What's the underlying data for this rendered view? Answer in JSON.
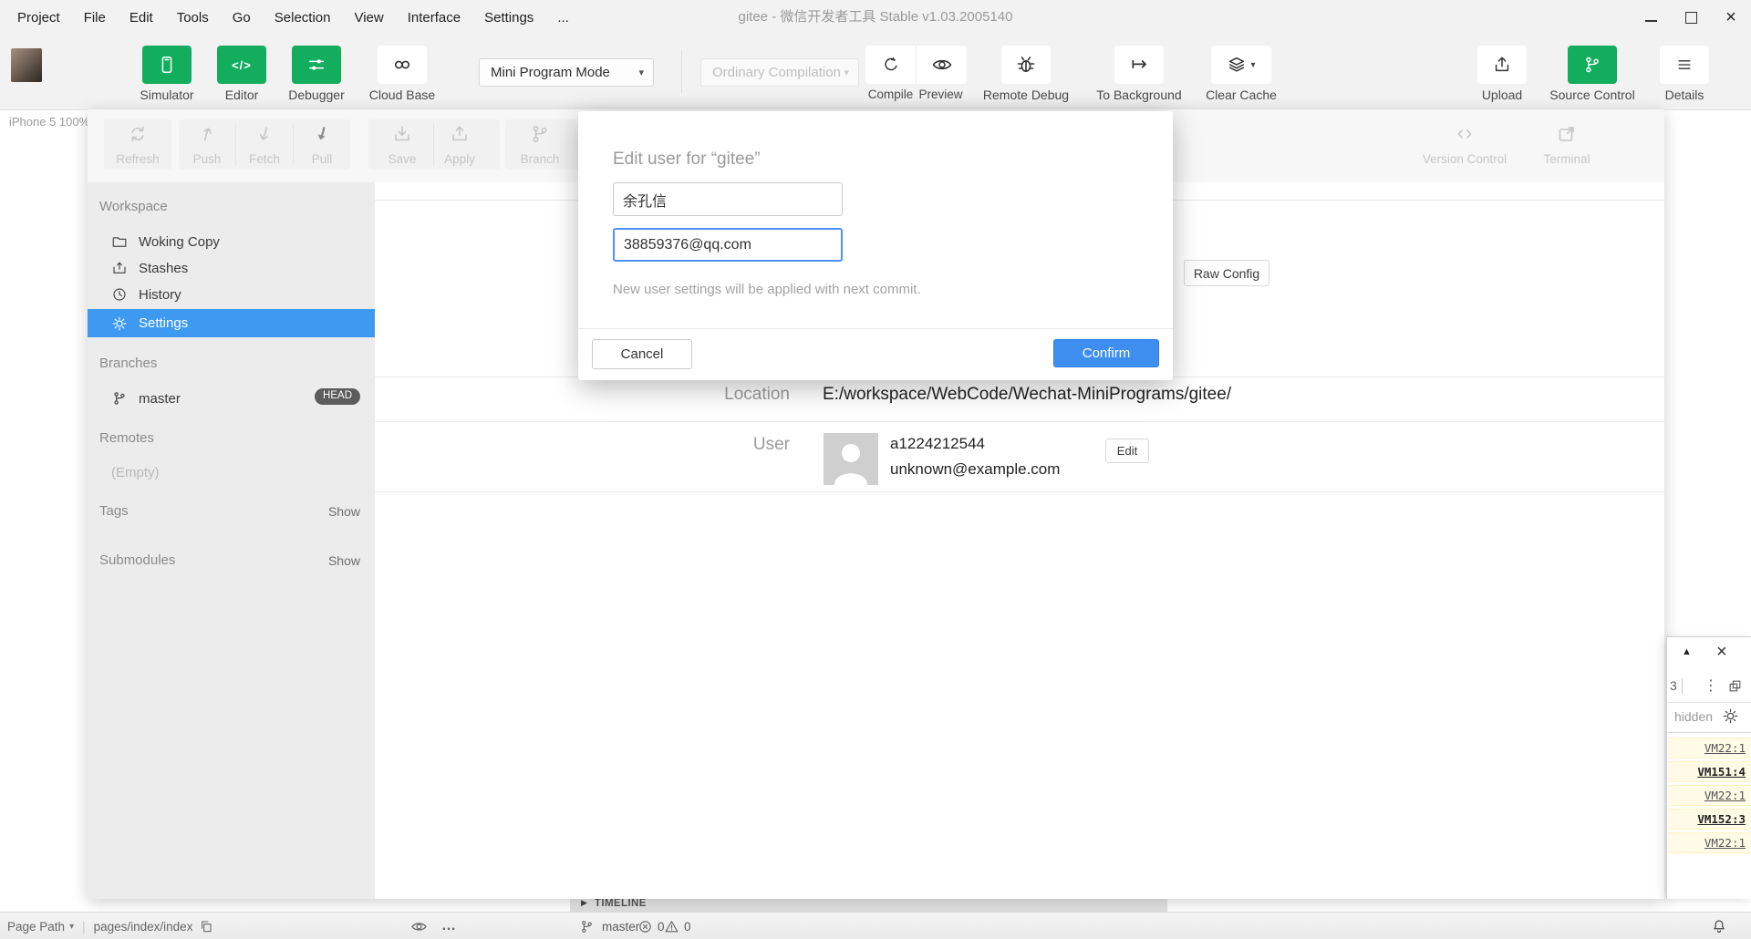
{
  "window": {
    "menu": [
      "Project",
      "File",
      "Edit",
      "Tools",
      "Go",
      "Selection",
      "View",
      "Interface",
      "Settings",
      "..."
    ],
    "title": "gitee - 微信开发者工具 Stable v1.03.2005140"
  },
  "toolbar": {
    "simulator": "Simulator",
    "editor": "Editor",
    "debugger": "Debugger",
    "cloud_base": "Cloud Base",
    "mode_select": "Mini Program Mode",
    "compile_select": "Ordinary Compilation",
    "compile": "Compile",
    "preview": "Preview",
    "remote_debug": "Remote Debug",
    "to_background": "To Background",
    "clear_cache": "Clear Cache",
    "upload": "Upload",
    "source_control": "Source Control",
    "details": "Details"
  },
  "simulator": {
    "device_label": "iPhone 5 100%"
  },
  "git": {
    "toolbar": {
      "refresh": "Refresh",
      "push": "Push",
      "fetch": "Fetch",
      "pull": "Pull",
      "save": "Save",
      "apply": "Apply",
      "branch": "Branch",
      "version_control": "Version Control",
      "terminal": "Terminal"
    },
    "sidebar": {
      "workspace_label": "Workspace",
      "items": [
        {
          "label": "Woking Copy"
        },
        {
          "label": "Stashes"
        },
        {
          "label": "History"
        },
        {
          "label": "Settings"
        }
      ],
      "branches_label": "Branches",
      "branch_name": "master",
      "head_badge": "HEAD",
      "remotes_label": "Remotes",
      "remotes_empty": "(Empty)",
      "tags_label": "Tags",
      "tags_action": "Show",
      "submodules_label": "Submodules",
      "submodules_action": "Show"
    },
    "settings": {
      "raw_config": "Raw Config",
      "location_label": "Location",
      "location_value": "E:/workspace/WebCode/Wechat-MiniPrograms/gitee/",
      "user_label": "User",
      "user_name": "a1224212544",
      "user_email": "unknown@example.com",
      "edit_button": "Edit"
    }
  },
  "dialog": {
    "title": "Edit user for “gitee”",
    "name_value": "余孔信",
    "email_value": "38859376@qq.com",
    "note": "New user settings will be applied with next commit.",
    "cancel": "Cancel",
    "confirm": "Confirm"
  },
  "console": {
    "count": "3",
    "filter": "hidden",
    "rows": [
      {
        "link": "VM22:1"
      },
      {
        "link": "VM151:4"
      },
      {
        "link": "VM22:1"
      },
      {
        "link": "VM152:3"
      },
      {
        "link": "VM22:1"
      }
    ]
  },
  "timeline": {
    "label": "TIMELINE"
  },
  "statusbar": {
    "page_path": "Page Path",
    "path_value": "pages/index/index",
    "branch": "master",
    "errors": "0",
    "warnings": "0"
  },
  "colors": {
    "brand_green": "#13ad5e",
    "accent_blue": "#3d9af0",
    "confirm_blue": "#3e8ef0",
    "warning_bg": "#fffbe6"
  }
}
